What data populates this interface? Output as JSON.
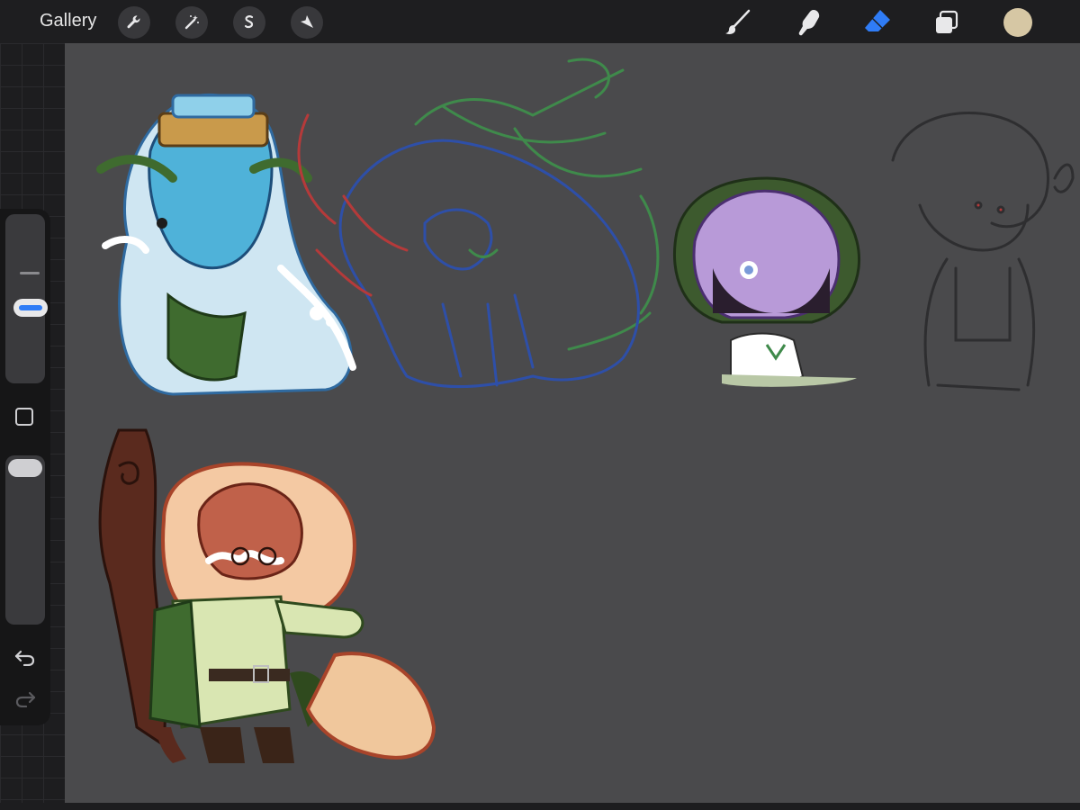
{
  "toolbar": {
    "gallery_label": "Gallery",
    "left_tools": [
      "wrench-icon",
      "magic-wand-icon",
      "selection-icon",
      "transform-arrow-icon"
    ],
    "right_tools": [
      "brush-icon",
      "smudge-icon",
      "eraser-icon",
      "layers-icon"
    ],
    "active_tool": "eraser",
    "accent_color": "#2f7cf6",
    "current_color": "#d6c7a4"
  },
  "sidebar": {
    "brush_size_level": 0.55,
    "opacity_level": 1.0
  },
  "colors": {
    "canvas_background": "#4a4a4c",
    "sketch_green": "#3f8a4b",
    "sketch_blue": "#2e4fa8",
    "sketch_red": "#b53a3a",
    "sketch_gray": "#2e2e30"
  }
}
